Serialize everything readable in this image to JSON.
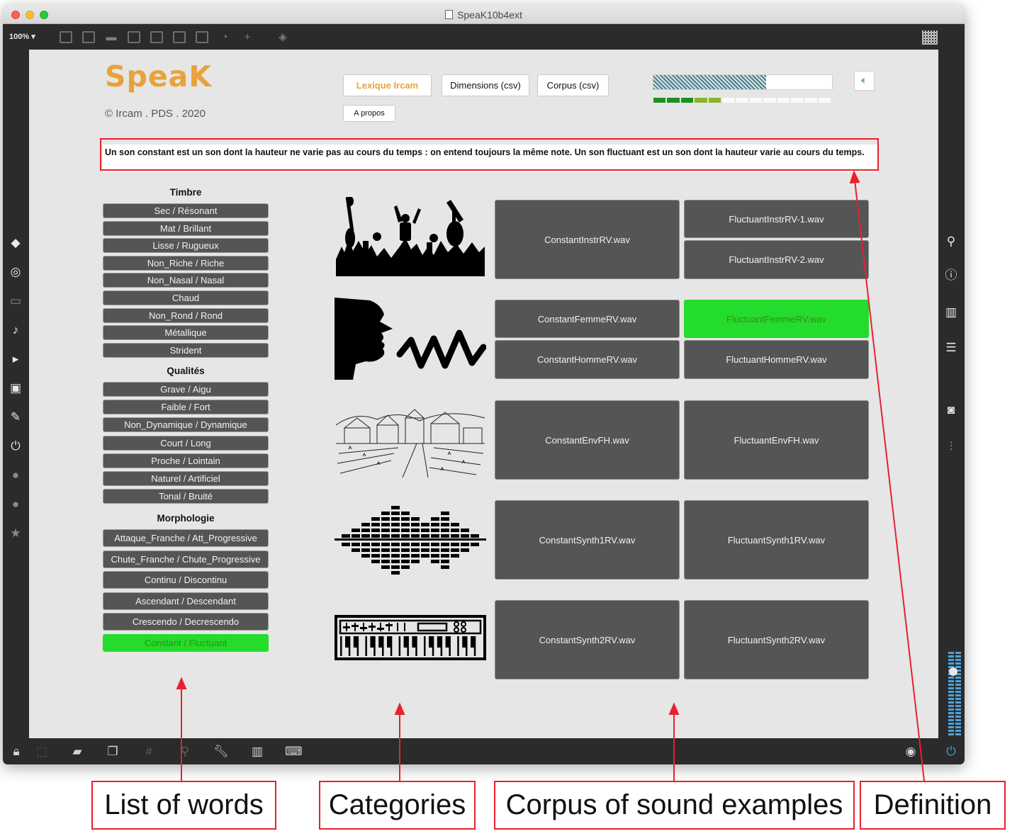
{
  "window": {
    "title": "SpeaK10b4ext",
    "zoom_label": "100%",
    "zoom_arrow": "▾"
  },
  "app": {
    "logo": "SpeaK",
    "copyright": "© Ircam . PDS . 2020",
    "accent_color": "#e9a23b",
    "active_color": "#23dc2b"
  },
  "nav": {
    "lexique": "Lexique Ircam",
    "dimensions": "Dimensions (csv)",
    "corpus": "Corpus (csv)",
    "apropos": "A propos"
  },
  "playback": {
    "progress_percent": 63,
    "level_leds_lit": 5,
    "level_leds_total": 13,
    "speaker_icon": "speaker-icon"
  },
  "definition": "Un son constant est un son dont la hauteur ne varie pas au cours du temps : on entend toujours la même note. Un son fluctuant est un son dont la hauteur varie au cours du temps.",
  "word_sections": {
    "timbre": {
      "title": "Timbre",
      "words": [
        "Sec / Résonant",
        "Mat / Brillant",
        "Lisse / Rugueux",
        "Non_Riche / Riche",
        "Non_Nasal / Nasal",
        "Chaud",
        "Non_Rond / Rond",
        "Métallique",
        "Strident"
      ]
    },
    "qualites": {
      "title": "Qualités",
      "words": [
        "Grave / Aigu",
        "Faible / Fort",
        "Non_Dynamique / Dynamique",
        "Court / Long",
        "Proche / Lointain",
        "Naturel / Artificiel",
        "Tonal / Bruité"
      ]
    },
    "morphologie": {
      "title": "Morphologie",
      "words": [
        "Attaque_Franche / Att_Progressive",
        "Chute_Franche / Chute_Progressive",
        "Continu / Discontinu",
        "Ascendant / Descendant",
        "Crescendo / Decrescendo",
        "Constant / Fluctuant"
      ],
      "active_index": 5
    }
  },
  "corpus": {
    "instruments": {
      "constant": [
        "ConstantInstrRV.wav"
      ],
      "fluctuant": [
        "FluctuantInstrRV-1.wav",
        "FluctuantInstrRV-2.wav"
      ]
    },
    "voice": {
      "constant": [
        "ConstantFemmeRV.wav",
        "ConstantHommeRV.wav"
      ],
      "fluctuant": [
        "FluctuantFemmeRV.wav",
        "FluctuantHommeRV.wav"
      ],
      "active": "FluctuantFemmeRV.wav"
    },
    "environment": {
      "constant": [
        "ConstantEnvFH.wav"
      ],
      "fluctuant": [
        "FluctuantEnvFH.wav"
      ]
    },
    "synth1": {
      "constant": [
        "ConstantSynth1RV.wav"
      ],
      "fluctuant": [
        "FluctuantSynth1RV.wav"
      ]
    },
    "synth2": {
      "constant": [
        "ConstantSynth2RV.wav"
      ],
      "fluctuant": [
        "FluctuantSynth2RV.wav"
      ]
    }
  },
  "annotations": {
    "words": "List of words",
    "categories": "Categories",
    "corpus": "Corpus of sound examples",
    "definition": "Definition",
    "color": "#e8212d"
  }
}
